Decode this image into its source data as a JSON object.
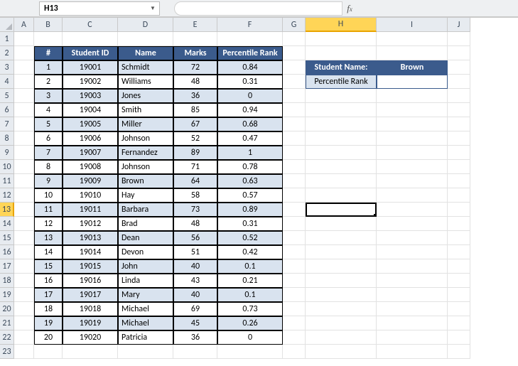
{
  "namebox": "H13",
  "formula": "",
  "columns": [
    "A",
    "B",
    "C",
    "D",
    "E",
    "F",
    "G",
    "H",
    "I",
    "J"
  ],
  "rows": [
    "1",
    "2",
    "3",
    "4",
    "5",
    "6",
    "7",
    "8",
    "9",
    "10",
    "11",
    "12",
    "13",
    "14",
    "15",
    "16",
    "17",
    "18",
    "19",
    "20",
    "21",
    "22",
    "23"
  ],
  "selected_col": "H",
  "selected_row": "13",
  "headers": {
    "num": "#",
    "id": "Student ID",
    "name": "Name",
    "marks": "Marks",
    "rank": "Percentile Rank"
  },
  "table": [
    {
      "num": "1",
      "id": "19001",
      "name": "Schmidt",
      "marks": "72",
      "rank": "0.84"
    },
    {
      "num": "2",
      "id": "19002",
      "name": "Williams",
      "marks": "48",
      "rank": "0.31"
    },
    {
      "num": "3",
      "id": "19003",
      "name": "Jones",
      "marks": "36",
      "rank": "0"
    },
    {
      "num": "4",
      "id": "19004",
      "name": "Smith",
      "marks": "85",
      "rank": "0.94"
    },
    {
      "num": "5",
      "id": "19005",
      "name": "Miller",
      "marks": "67",
      "rank": "0.68"
    },
    {
      "num": "6",
      "id": "19006",
      "name": "Johnson",
      "marks": "52",
      "rank": "0.47"
    },
    {
      "num": "7",
      "id": "19007",
      "name": "Fernandez",
      "marks": "89",
      "rank": "1"
    },
    {
      "num": "8",
      "id": "19008",
      "name": "Johnson",
      "marks": "71",
      "rank": "0.78"
    },
    {
      "num": "9",
      "id": "19009",
      "name": "Brown",
      "marks": "64",
      "rank": "0.63"
    },
    {
      "num": "10",
      "id": "19010",
      "name": "Hay",
      "marks": "58",
      "rank": "0.57"
    },
    {
      "num": "11",
      "id": "19011",
      "name": "Barbara",
      "marks": "73",
      "rank": "0.89"
    },
    {
      "num": "12",
      "id": "19012",
      "name": "Brad",
      "marks": "48",
      "rank": "0.31"
    },
    {
      "num": "13",
      "id": "19013",
      "name": "Dean",
      "marks": "56",
      "rank": "0.52"
    },
    {
      "num": "14",
      "id": "19014",
      "name": "Devon",
      "marks": "51",
      "rank": "0.42"
    },
    {
      "num": "15",
      "id": "19015",
      "name": "John",
      "marks": "40",
      "rank": "0.1"
    },
    {
      "num": "16",
      "id": "19016",
      "name": "Linda",
      "marks": "43",
      "rank": "0.21"
    },
    {
      "num": "17",
      "id": "19017",
      "name": "Mary",
      "marks": "40",
      "rank": "0.1"
    },
    {
      "num": "18",
      "id": "19018",
      "name": "Michael",
      "marks": "69",
      "rank": "0.73"
    },
    {
      "num": "19",
      "id": "19019",
      "name": "Michael",
      "marks": "45",
      "rank": "0.26"
    },
    {
      "num": "20",
      "id": "19020",
      "name": "Patricia",
      "marks": "36",
      "rank": "0"
    }
  ],
  "lookup": {
    "label1": "Student Name:",
    "value1": "Brown",
    "label2": "Percentile Rank",
    "value2": ""
  }
}
